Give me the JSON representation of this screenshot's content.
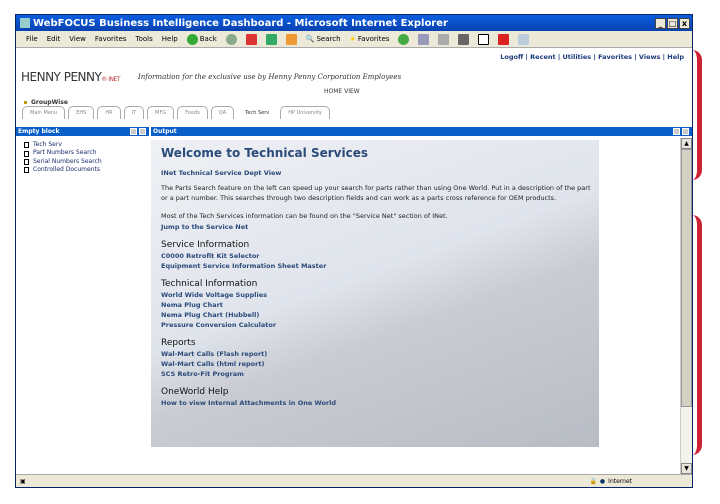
{
  "window": {
    "title": "WebFOCUS Business Intelligence Dashboard - Microsoft Internet Explorer"
  },
  "menu": [
    "File",
    "Edit",
    "View",
    "Favorites",
    "Tools",
    "Help"
  ],
  "toolbar": {
    "back": "Back",
    "search": "Search",
    "favorites": "Favorites"
  },
  "toplinks": "Logoff | Recent | Utilities | Favorites | Views | Help",
  "header": {
    "logo": "HENNY PENNY",
    "logo_suffix": "® INET",
    "tagline": "Information for the exclusive use by Henny Penny Corporation Employees",
    "home_view": "HOME VIEW",
    "groupwise": "GroupWise"
  },
  "tabs": [
    {
      "label": "Main Menu"
    },
    {
      "label": "EHS"
    },
    {
      "label": "HR"
    },
    {
      "label": "IT"
    },
    {
      "label": "MFG"
    },
    {
      "label": "Foods"
    },
    {
      "label": "QA"
    },
    {
      "label": "Tech Serv",
      "active": true
    },
    {
      "label": "HP University"
    }
  ],
  "left_panel": {
    "title": "Empty block",
    "items": [
      "Tech Serv",
      "Part Numbers Search",
      "Serial Numbers Search",
      "Controlled Documents"
    ]
  },
  "output": {
    "title": "Output",
    "heading": "Welcome to Technical Services",
    "subheading": "INet Technical Service Dept View",
    "para1": "The Parts Search feature on the left can speed up your search for parts rather than using One World. Put in a description of the part or a part number. This searches through two description fields and can work as a parts cross reference for OEM products.",
    "para2": "Most of the Tech Services information can be found on the \"Service Net\" section of INet.",
    "jump": "Jump to the Service Net",
    "sections": [
      {
        "title": "Service Information",
        "links": [
          "C0000 Retrofit Kit Selector",
          "Equipment Service Information Sheet Master"
        ]
      },
      {
        "title": "Technical Information",
        "links": [
          "World Wide Voltage Supplies",
          "Nema Plug Chart",
          "Nema Plug Chart (Hubbell)",
          "Pressure Conversion Calculator"
        ]
      },
      {
        "title": "Reports",
        "links": [
          "Wal-Mart Calls (Flash report)",
          "Wal-Mart Calls (html report)",
          "SCS Retro-Fit Program"
        ]
      },
      {
        "title": "OneWorld Help",
        "links": [
          "How to view Internal Attachments in One World"
        ]
      }
    ]
  },
  "status": {
    "zone": "Internet"
  }
}
